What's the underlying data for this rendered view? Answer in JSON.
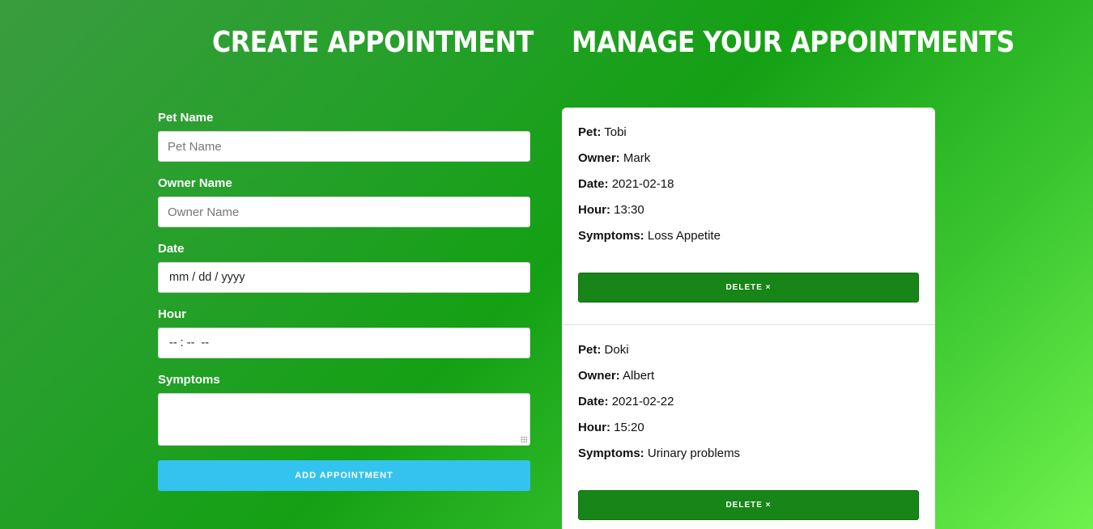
{
  "headings": {
    "create": "Create Appointment",
    "manage": "Manage your Appointments"
  },
  "form": {
    "pet_name": {
      "label": "Pet Name",
      "placeholder": "Pet Name",
      "value": ""
    },
    "owner_name": {
      "label": "Owner Name",
      "placeholder": "Owner Name",
      "value": ""
    },
    "date": {
      "label": "Date",
      "display": "mm / dd / yyyy"
    },
    "hour": {
      "label": "Hour",
      "display": "-- : --  --"
    },
    "symptoms": {
      "label": "Symptoms",
      "value": ""
    },
    "submit_label": "Add Appointment"
  },
  "appointments": [
    {
      "pet_label": "Pet:",
      "pet": "Tobi",
      "owner_label": "Owner:",
      "owner": "Mark",
      "date_label": "Date:",
      "date": "2021-02-18",
      "hour_label": "Hour:",
      "hour": "13:30",
      "symptoms_label": "Symptoms:",
      "symptoms": "Loss Appetite",
      "delete_label": "Delete ×"
    },
    {
      "pet_label": "Pet:",
      "pet": "Doki",
      "owner_label": "Owner:",
      "owner": "Albert",
      "date_label": "Date:",
      "date": "2021-02-22",
      "hour_label": "Hour:",
      "hour": "15:20",
      "symptoms_label": "Symptoms:",
      "symptoms": "Urinary problems",
      "delete_label": "Delete ×"
    }
  ],
  "colors": {
    "background_gradient": [
      "#3a9c3e",
      "#14a014",
      "#6ef24c"
    ],
    "add_button": "#33c3ee",
    "delete_button": "#188518",
    "panel": "#ffffff"
  }
}
